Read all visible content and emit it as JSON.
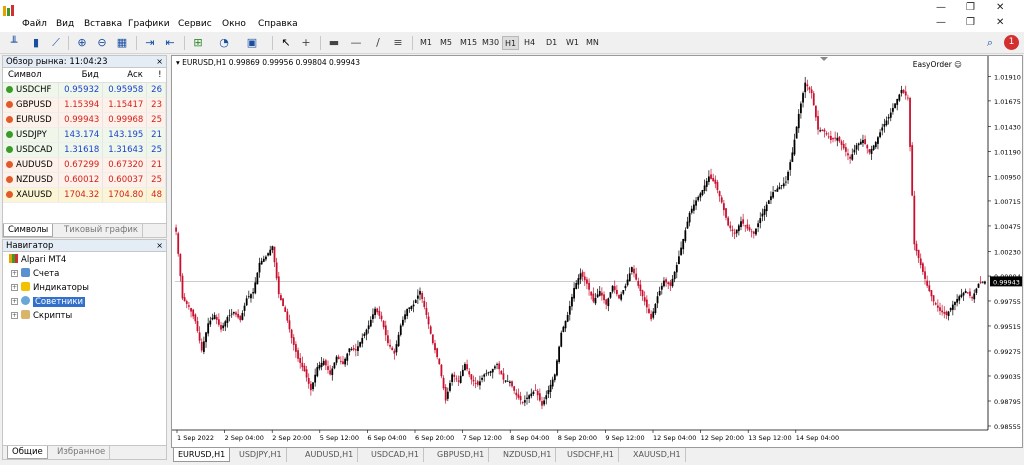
{
  "menu": {
    "items": [
      "Файл",
      "Вид",
      "Вставка",
      "Графики",
      "Сервис",
      "Окно",
      "Справка"
    ]
  },
  "toolbar": {
    "timeframes": [
      "M1",
      "M5",
      "M15",
      "M30",
      "H1",
      "H4",
      "D1",
      "W1",
      "MN"
    ],
    "active_timeframe": "H1",
    "notification_count": "1"
  },
  "market_watch": {
    "title": "Обзор рынка: 11:04:23",
    "headers": {
      "symbol": "Символ",
      "bid": "Бид",
      "ask": "Аск",
      "spread": "!"
    },
    "rows": [
      {
        "symbol": "USDCHF",
        "bid": "0.95932",
        "ask": "0.95958",
        "spread": "26",
        "dir": "up"
      },
      {
        "symbol": "GBPUSD",
        "bid": "1.15394",
        "ask": "1.15417",
        "spread": "23",
        "dir": "down"
      },
      {
        "symbol": "EURUSD",
        "bid": "0.99943",
        "ask": "0.99968",
        "spread": "25",
        "dir": "down"
      },
      {
        "symbol": "USDJPY",
        "bid": "143.174",
        "ask": "143.195",
        "spread": "21",
        "dir": "up"
      },
      {
        "symbol": "USDCAD",
        "bid": "1.31618",
        "ask": "1.31643",
        "spread": "25",
        "dir": "up"
      },
      {
        "symbol": "AUDUSD",
        "bid": "0.67299",
        "ask": "0.67320",
        "spread": "21",
        "dir": "down"
      },
      {
        "symbol": "NZDUSD",
        "bid": "0.60012",
        "ask": "0.60037",
        "spread": "25",
        "dir": "down"
      },
      {
        "symbol": "XAUUSD",
        "bid": "1704.32",
        "ask": "1704.80",
        "spread": "48",
        "dir": "down"
      }
    ],
    "tabs": {
      "symbols": "Символы",
      "tick_chart": "Тиковый график"
    }
  },
  "navigator": {
    "title": "Навигатор",
    "root": "Alpari MT4",
    "items": [
      "Счета",
      "Индикаторы",
      "Советники",
      "Скрипты"
    ],
    "selected": "Советники",
    "tabs": {
      "common": "Общие",
      "favorites": "Избранное"
    }
  },
  "chart": {
    "header": "EURUSD,H1  0.99869 0.99956 0.99804 0.99943",
    "ea_label": "EasyOrder ☺",
    "current_price": "0.99943",
    "tabs": [
      "EURUSD,H1",
      "USDJPY,H1",
      "AUDUSD,H1",
      "USDCAD,H1",
      "GBPUSD,H1",
      "NZDUSD,H1",
      "USDCHF,H1",
      "XAUUSD,H1"
    ],
    "active_tab": "EURUSD,H1"
  },
  "chart_data": {
    "type": "candlestick",
    "symbol": "EURUSD",
    "timeframe": "H1",
    "x_tick_labels": [
      "1 Sep 2022",
      "2 Sep 04:00",
      "2 Sep 20:00",
      "5 Sep 12:00",
      "6 Sep 04:00",
      "6 Sep 20:00",
      "7 Sep 12:00",
      "8 Sep 04:00",
      "8 Sep 20:00",
      "9 Sep 12:00",
      "12 Sep 04:00",
      "12 Sep 20:00",
      "13 Sep 12:00",
      "14 Sep 04:00"
    ],
    "y_tick_labels": [
      "1.01910",
      "1.01675",
      "1.01430",
      "1.01190",
      "1.00950",
      "1.00715",
      "1.00475",
      "1.00230",
      "0.99994",
      "0.99755",
      "0.99515",
      "0.99275",
      "0.99035",
      "0.98795",
      "0.98555"
    ],
    "ylim": [
      0.98555,
      1.0201
    ],
    "bull_color": "#000000",
    "bear_color": "#c8102e",
    "close_path": [
      [
        0,
        1.0042
      ],
      [
        3,
        0.9978
      ],
      [
        6,
        0.997
      ],
      [
        9,
        0.9956
      ],
      [
        12,
        0.9928
      ],
      [
        15,
        0.9954
      ],
      [
        18,
        0.9962
      ],
      [
        21,
        0.9948
      ],
      [
        24,
        0.996
      ],
      [
        27,
        0.9965
      ],
      [
        30,
        0.9957
      ],
      [
        33,
        0.9978
      ],
      [
        36,
        0.9984
      ],
      [
        39,
        1.0012
      ],
      [
        42,
        1.0018
      ],
      [
        45,
        1.0028
      ],
      [
        48,
        0.9982
      ],
      [
        51,
        0.9965
      ],
      [
        54,
        0.994
      ],
      [
        57,
        0.992
      ],
      [
        60,
        0.9908
      ],
      [
        63,
        0.989
      ],
      [
        66,
        0.9912
      ],
      [
        69,
        0.9918
      ],
      [
        72,
        0.9905
      ],
      [
        75,
        0.9922
      ],
      [
        78,
        0.9915
      ],
      [
        81,
        0.993
      ],
      [
        84,
        0.9928
      ],
      [
        87,
        0.994
      ],
      [
        90,
        0.9952
      ],
      [
        93,
        0.9968
      ],
      [
        96,
        0.9958
      ],
      [
        99,
        0.9935
      ],
      [
        102,
        0.9925
      ],
      [
        105,
        0.9952
      ],
      [
        108,
        0.9968
      ],
      [
        111,
        0.9972
      ],
      [
        114,
        0.9985
      ],
      [
        117,
        0.9962
      ],
      [
        120,
        0.9935
      ],
      [
        123,
        0.9915
      ],
      [
        126,
        0.988
      ],
      [
        129,
        0.9905
      ],
      [
        132,
        0.9898
      ],
      [
        135,
        0.9915
      ],
      [
        138,
        0.99
      ],
      [
        141,
        0.9895
      ],
      [
        144,
        0.9905
      ],
      [
        147,
        0.9908
      ],
      [
        150,
        0.9915
      ],
      [
        153,
        0.99
      ],
      [
        156,
        0.9898
      ],
      [
        159,
        0.9885
      ],
      [
        162,
        0.9878
      ],
      [
        165,
        0.9885
      ],
      [
        168,
        0.989
      ],
      [
        171,
        0.9875
      ],
      [
        174,
        0.989
      ],
      [
        177,
        0.9905
      ],
      [
        180,
        0.9945
      ],
      [
        183,
        0.9962
      ],
      [
        186,
        0.9988
      ],
      [
        189,
        1.0002
      ],
      [
        192,
        0.9992
      ],
      [
        195,
        0.9975
      ],
      [
        198,
        0.9985
      ],
      [
        201,
        0.9972
      ],
      [
        204,
        0.999
      ],
      [
        207,
        0.9978
      ],
      [
        210,
        0.999
      ],
      [
        213,
        1.0008
      ],
      [
        216,
        0.999
      ],
      [
        219,
        0.9975
      ],
      [
        222,
        0.9958
      ],
      [
        225,
        0.998
      ],
      [
        228,
        0.9995
      ],
      [
        231,
        0.999
      ],
      [
        234,
        1.001
      ],
      [
        237,
        1.0035
      ],
      [
        240,
        1.006
      ],
      [
        243,
        1.0072
      ],
      [
        246,
        1.0082
      ],
      [
        249,
        1.0095
      ],
      [
        252,
        1.0088
      ],
      [
        255,
        1.007
      ],
      [
        258,
        1.0048
      ],
      [
        261,
        1.004
      ],
      [
        264,
        1.0052
      ],
      [
        267,
        1.0045
      ],
      [
        270,
        1.004
      ],
      [
        273,
        1.0055
      ],
      [
        276,
        1.0068
      ],
      [
        279,
        1.008
      ],
      [
        282,
        1.0085
      ],
      [
        285,
        1.009
      ],
      [
        288,
        1.0118
      ],
      [
        291,
        1.0155
      ],
      [
        294,
        1.0185
      ],
      [
        297,
        1.0175
      ],
      [
        300,
        1.014
      ],
      [
        303,
        1.0138
      ],
      [
        306,
        1.013
      ],
      [
        309,
        1.0132
      ],
      [
        312,
        1.0122
      ],
      [
        315,
        1.0112
      ],
      [
        318,
        1.0125
      ],
      [
        321,
        1.013
      ],
      [
        324,
        1.0118
      ],
      [
        327,
        1.0128
      ],
      [
        330,
        1.0142
      ],
      [
        333,
        1.0152
      ],
      [
        336,
        1.0165
      ],
      [
        339,
        1.0178
      ],
      [
        342,
        1.017
      ],
      [
        345,
        1.003
      ],
      [
        348,
        1.001
      ],
      [
        351,
        0.999
      ],
      [
        354,
        0.9975
      ],
      [
        357,
        0.9966
      ],
      [
        360,
        0.9962
      ],
      [
        363,
        0.9972
      ],
      [
        366,
        0.998
      ],
      [
        369,
        0.9985
      ],
      [
        372,
        0.9978
      ],
      [
        375,
        0.9992
      ],
      [
        378,
        0.9994
      ]
    ]
  }
}
